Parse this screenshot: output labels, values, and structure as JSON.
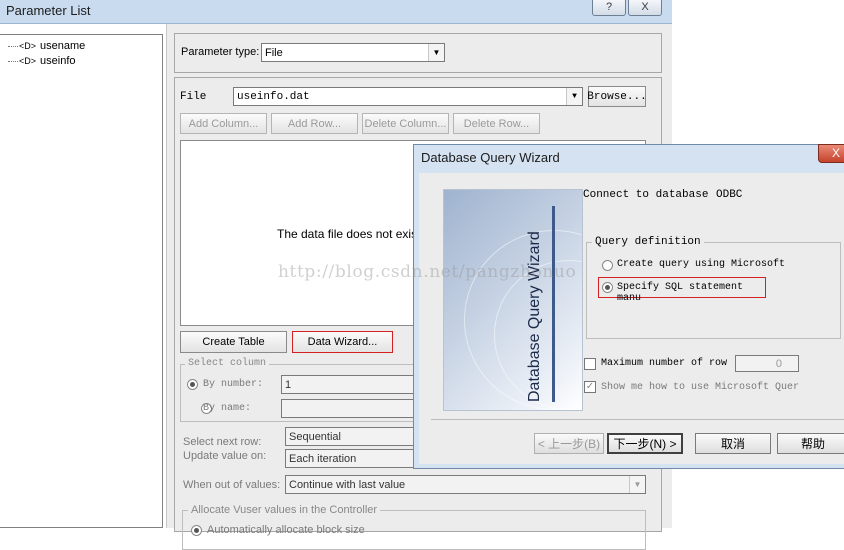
{
  "window": {
    "title": "Parameter List",
    "help_label": "?",
    "close_label": "X"
  },
  "tree": {
    "items": [
      {
        "tag": "<D>",
        "label": "usename"
      },
      {
        "tag": "<D>",
        "label": "useinfo"
      }
    ]
  },
  "parameter": {
    "type_label": "Parameter type:",
    "type_value": "File",
    "file_label": "File",
    "file_value": "useinfo.dat",
    "browse_label": "Browse..."
  },
  "toolbar": {
    "add_column": "Add Column...",
    "add_row": "Add Row...",
    "delete_column": "Delete Column...",
    "delete_row": "Delete Row..."
  },
  "data_area": {
    "message": "The data file does not exist. T"
  },
  "actions": {
    "create_table": "Create Table",
    "data_wizard": "Data Wizard..."
  },
  "select_column": {
    "legend": "Select column",
    "by_number_label": "By number:",
    "by_number_value": "1",
    "by_name_label": "By name:"
  },
  "options": {
    "select_next_row_label": "Select next row:",
    "select_next_row_value": "Sequential",
    "update_value_label": "Update value on:",
    "update_value_value": "Each iteration",
    "out_of_values_label": "When out of values:",
    "out_of_values_value": "Continue with last value"
  },
  "allocate": {
    "legend": "Allocate Vuser values in the Controller",
    "auto_label": "Automatically allocate block size"
  },
  "dialog": {
    "title": "Database Query Wizard",
    "close_label": "X",
    "image_text": "Database Query Wizard",
    "connect_label": "Connect to database",
    "connect_value": "ODBC",
    "query_definition_legend": "Query definition",
    "option_create": "Create query using Microsoft",
    "option_specify": "Specify SQL statement manu",
    "max_rows_label": "Maximum number of row",
    "max_rows_value": "0",
    "show_me_label": "Show me how to use Microsoft Quer",
    "back_button": "< 上一步(B)",
    "next_button": "下一步(N) >",
    "cancel_button": "取消",
    "help_button": "帮助"
  },
  "watermark": "http://blog.csdn.net/pangzhonuo"
}
